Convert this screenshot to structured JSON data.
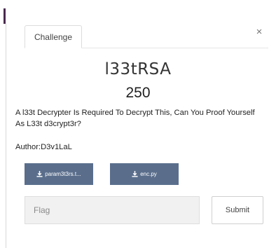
{
  "tab": {
    "label": "Challenge"
  },
  "close": {
    "glyph": "×"
  },
  "challenge": {
    "title": "l33tRSA",
    "points": "250",
    "description": "A l33t Decrypter Is Required To Decrypt This, Can You Proof Yourself As L33t d3crypt3r?",
    "author": "Author:D3v1LaL"
  },
  "files": [
    {
      "label": "param3t3rs.t...",
      "icon": "download-icon"
    },
    {
      "label": "enc.py",
      "icon": "download-icon"
    }
  ],
  "flag": {
    "placeholder": "Flag",
    "value": ""
  },
  "submit": {
    "label": "Submit"
  },
  "colors": {
    "accent": "#4a2a4f",
    "file_button_bg": "#5a6e8c",
    "input_bg": "#f1f1f1"
  }
}
